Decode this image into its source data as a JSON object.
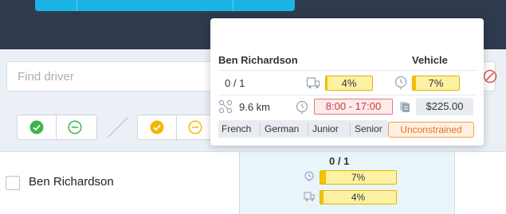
{
  "search": {
    "placeholder": "Find driver"
  },
  "row": {
    "driver_name": "Ben Richardson",
    "cell": {
      "count": "0 / 1",
      "time_pct_label": "7%",
      "time_pct": 0.07,
      "volume_pct_label": "4%",
      "volume_pct": 0.04
    }
  },
  "tooltip": {
    "driver_name": "Ben Richardson",
    "vehicle_label": "Vehicle",
    "count": "0 / 1",
    "volume_pct_label": "4%",
    "volume_pct": 0.04,
    "time_pct_label": "7%",
    "time_pct": 0.07,
    "distance": "9.6 km",
    "time_window": "8:00 - 17:00",
    "cost": "$225.00",
    "skills": [
      "French",
      "German",
      "Junior",
      "Senior"
    ],
    "constraint": "Unconstrained"
  },
  "icons": {
    "clear": "clear-icon",
    "check": "check-circle-icon",
    "minus": "minus-circle-icon",
    "clock": "clock-icon",
    "truck_load": "truck-load-icon",
    "route": "route-icon",
    "money": "money-icon"
  },
  "colors": {
    "topbar": "#2f3a4f",
    "accent": "#19b3e6",
    "success": "#3bb54a",
    "warning": "#f2b705",
    "danger": "#e05555",
    "orange": "#e2702a"
  }
}
